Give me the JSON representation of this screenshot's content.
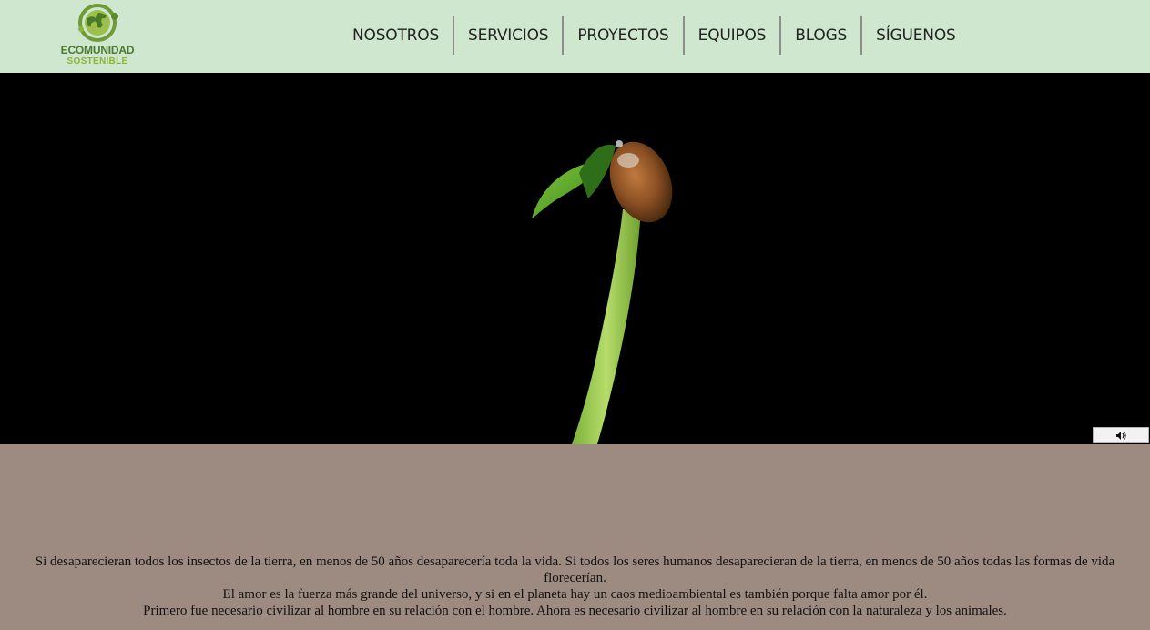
{
  "header": {
    "logo": {
      "line1": "ECOMUNIDAD",
      "line2": "SOSTENIBLE",
      "icon": "globe-leaf-icon"
    },
    "nav": [
      {
        "label": "NOSOTROS"
      },
      {
        "label": "SERVICIOS"
      },
      {
        "label": "PROYECTOS"
      },
      {
        "label": "EQUIPOS"
      },
      {
        "label": "BLOGS"
      },
      {
        "label": "SÍGUENOS"
      }
    ]
  },
  "video": {
    "scene": "seedling-sprout",
    "volume_icon": "speaker-icon"
  },
  "quotes": [
    "Si desaparecieran todos los insectos de la tierra, en menos de 50 años desaparecería toda la vida. Si todos los seres humanos desaparecieran de la tierra, en menos de 50 años todas las formas de vida florecerían.",
    "El amor es la fuerza más grande del universo, y si en el planeta hay un caos medioambiental es también porque falta amor por él.",
    "Primero fue necesario civilizar al hombre en su relación con el hombre. Ahora es necesario civilizar al hombre en su relación con la naturaleza y los animales."
  ],
  "colors": {
    "header_bg": "#cfe6cf",
    "body_bg": "#9d8b82",
    "logo_green_dark": "#4a7a2a",
    "logo_green_light": "#8ab43a"
  }
}
